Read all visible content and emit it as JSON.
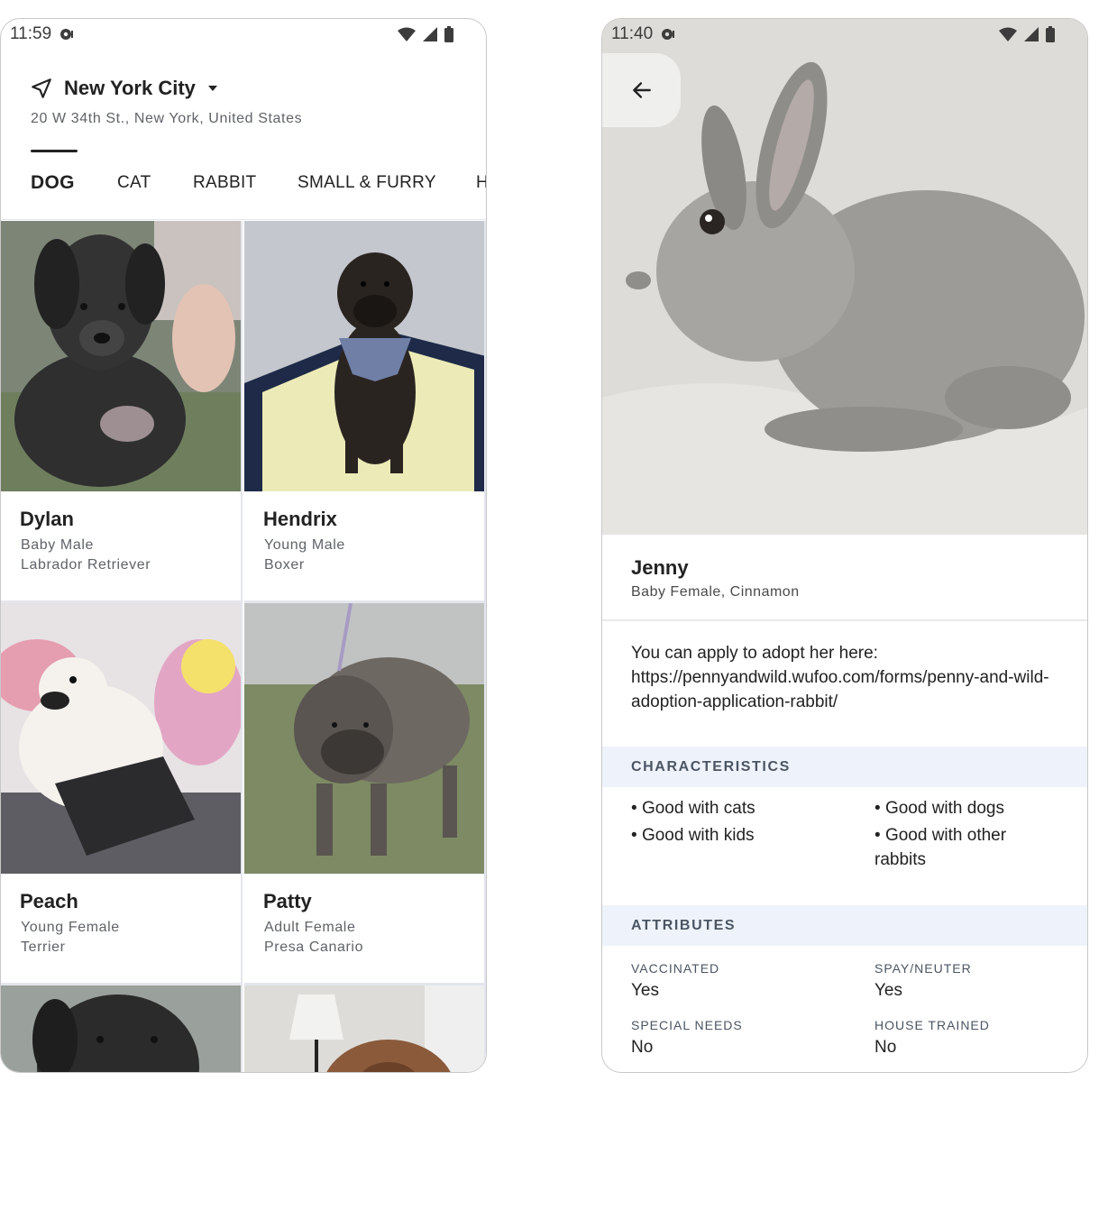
{
  "browse_screen": {
    "status": {
      "time": "11:59"
    },
    "location": {
      "city": "New York City",
      "address": "20 W 34th St., New York, United States"
    },
    "tabs": [
      {
        "label": "DOG",
        "active": true
      },
      {
        "label": "CAT",
        "active": false
      },
      {
        "label": "RABBIT",
        "active": false
      },
      {
        "label": "SMALL & FURRY",
        "active": false
      },
      {
        "label": "H",
        "active": false
      }
    ],
    "pets": [
      {
        "name": "Dylan",
        "age_gender": "Baby Male",
        "breed": "Labrador Retriever"
      },
      {
        "name": "Hendrix",
        "age_gender": "Young Male",
        "breed": "Boxer"
      },
      {
        "name": "Peach",
        "age_gender": "Young Female",
        "breed": "Terrier"
      },
      {
        "name": "Patty",
        "age_gender": "Adult Female",
        "breed": "Presa Canario"
      }
    ]
  },
  "detail_screen": {
    "status": {
      "time": "11:40"
    },
    "pet": {
      "name": "Jenny",
      "subtitle": "Baby Female, Cinnamon",
      "description": "You can apply to adopt her here: https://pennyandwild.wufoo.com/forms/penny-and-wild-adoption-application-rabbit/"
    },
    "characteristics": {
      "heading": "CHARACTERISTICS",
      "items": [
        "Good with cats",
        "Good with dogs",
        "Good with kids",
        "Good with other rabbits"
      ]
    },
    "attributes": {
      "heading": "ATTRIBUTES",
      "items": [
        {
          "label": "VACCINATED",
          "value": "Yes"
        },
        {
          "label": "SPAY/NEUTER",
          "value": "Yes"
        },
        {
          "label": "SPECIAL NEEDS",
          "value": "No"
        },
        {
          "label": "HOUSE TRAINED",
          "value": "No"
        }
      ]
    }
  }
}
